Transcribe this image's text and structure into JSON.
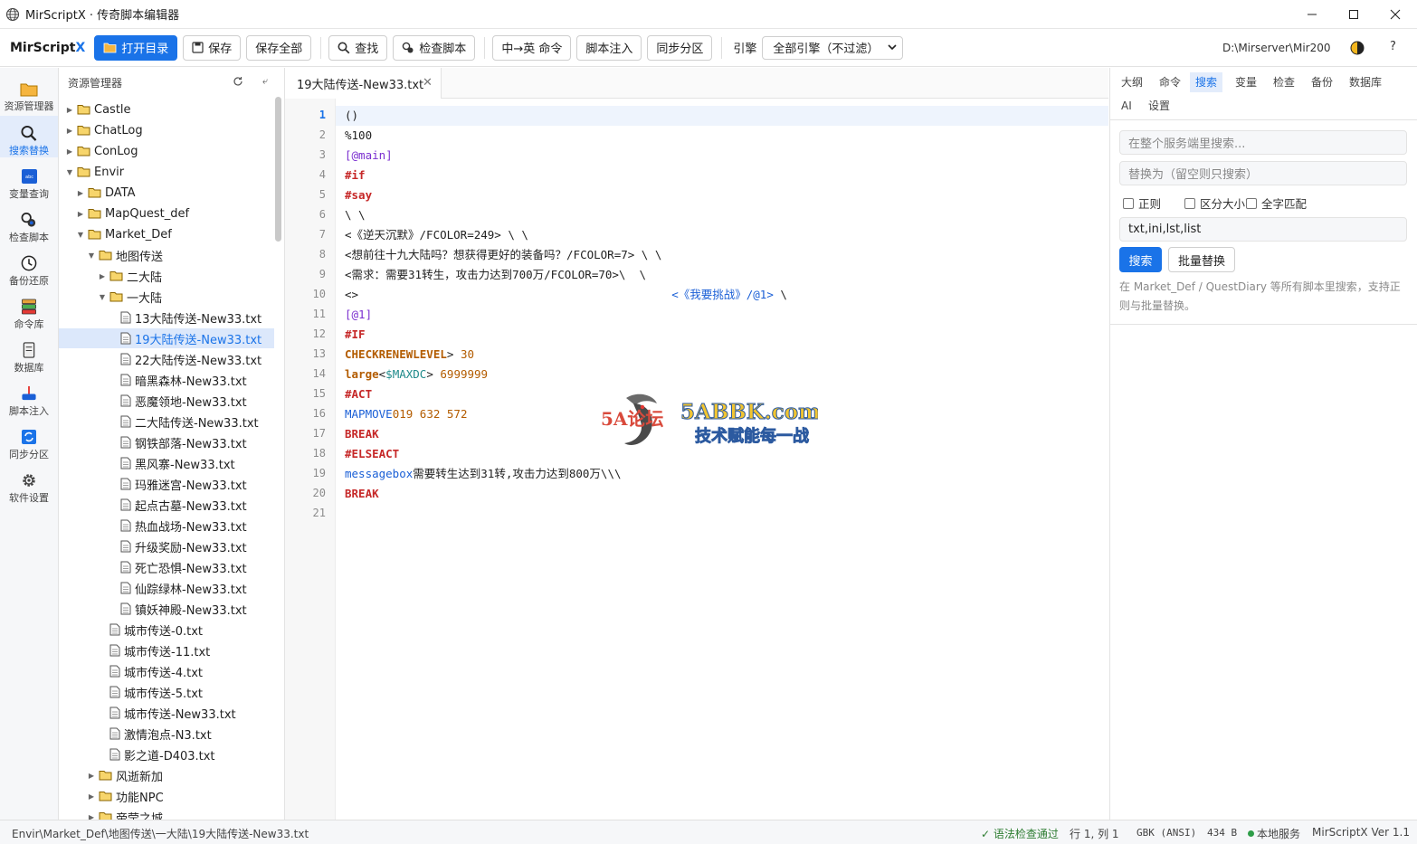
{
  "window": {
    "title": "MirScriptX · 传奇脚本编辑器"
  },
  "toolbar": {
    "brand_main": "MirScript",
    "brand_x": "X",
    "open_dir": "打开目录",
    "save": "保存",
    "save_all": "保存全部",
    "find": "查找",
    "check_script": "检查脚本",
    "translate_cmd": "中→英 命令",
    "inject": "脚本注入",
    "sync_zone": "同步分区",
    "engine_label": "引擎",
    "engine_select": "全部引擎（不过滤）",
    "server_path": "D:\\Mirserver\\Mir200",
    "help": "?"
  },
  "activity": [
    {
      "label": "资源管理器",
      "icon": "folder-icon"
    },
    {
      "label": "搜索替换",
      "icon": "search-icon"
    },
    {
      "label": "变量查询",
      "icon": "variable-icon"
    },
    {
      "label": "检查脚本",
      "icon": "bug-check-icon"
    },
    {
      "label": "备份还原",
      "icon": "clock-icon"
    },
    {
      "label": "命令库",
      "icon": "stack-icon"
    },
    {
      "label": "数据库",
      "icon": "database-icon"
    },
    {
      "label": "脚本注入",
      "icon": "inject-icon"
    },
    {
      "label": "同步分区",
      "icon": "sync-icon"
    },
    {
      "label": "软件设置",
      "icon": "gear-icon"
    }
  ],
  "explorer": {
    "title": "资源管理器",
    "tree": [
      {
        "label": "Castle",
        "depth": 0,
        "type": "folder",
        "expanded": false
      },
      {
        "label": "ChatLog",
        "depth": 0,
        "type": "folder",
        "expanded": false
      },
      {
        "label": "ConLog",
        "depth": 0,
        "type": "folder",
        "expanded": false
      },
      {
        "label": "Envir",
        "depth": 0,
        "type": "folder",
        "expanded": true
      },
      {
        "label": "DATA",
        "depth": 1,
        "type": "folder",
        "expanded": false
      },
      {
        "label": "MapQuest_def",
        "depth": 1,
        "type": "folder",
        "expanded": false
      },
      {
        "label": "Market_Def",
        "depth": 1,
        "type": "folder",
        "expanded": true
      },
      {
        "label": "地图传送",
        "depth": 2,
        "type": "folder",
        "expanded": true
      },
      {
        "label": "二大陆",
        "depth": 3,
        "type": "folder",
        "expanded": false
      },
      {
        "label": "一大陆",
        "depth": 3,
        "type": "folder",
        "expanded": true
      },
      {
        "label": "13大陆传送-New33.txt",
        "depth": 4,
        "type": "file"
      },
      {
        "label": "19大陆传送-New33.txt",
        "depth": 4,
        "type": "file",
        "selected": true
      },
      {
        "label": "22大陆传送-New33.txt",
        "depth": 4,
        "type": "file"
      },
      {
        "label": "暗黑森林-New33.txt",
        "depth": 4,
        "type": "file"
      },
      {
        "label": "恶魔领地-New33.txt",
        "depth": 4,
        "type": "file"
      },
      {
        "label": "二大陆传送-New33.txt",
        "depth": 4,
        "type": "file"
      },
      {
        "label": "钢铁部落-New33.txt",
        "depth": 4,
        "type": "file"
      },
      {
        "label": "黑风寨-New33.txt",
        "depth": 4,
        "type": "file"
      },
      {
        "label": "玛雅迷宫-New33.txt",
        "depth": 4,
        "type": "file"
      },
      {
        "label": "起点古墓-New33.txt",
        "depth": 4,
        "type": "file"
      },
      {
        "label": "热血战场-New33.txt",
        "depth": 4,
        "type": "file"
      },
      {
        "label": "升级奖励-New33.txt",
        "depth": 4,
        "type": "file"
      },
      {
        "label": "死亡恐惧-New33.txt",
        "depth": 4,
        "type": "file"
      },
      {
        "label": "仙踪绿林-New33.txt",
        "depth": 4,
        "type": "file"
      },
      {
        "label": "镇妖神殿-New33.txt",
        "depth": 4,
        "type": "file"
      },
      {
        "label": "城市传送-0.txt",
        "depth": 3,
        "type": "file"
      },
      {
        "label": "城市传送-11.txt",
        "depth": 3,
        "type": "file"
      },
      {
        "label": "城市传送-4.txt",
        "depth": 3,
        "type": "file"
      },
      {
        "label": "城市传送-5.txt",
        "depth": 3,
        "type": "file"
      },
      {
        "label": "城市传送-New33.txt",
        "depth": 3,
        "type": "file"
      },
      {
        "label": "激情泡点-N3.txt",
        "depth": 3,
        "type": "file"
      },
      {
        "label": "影之道-D403.txt",
        "depth": 3,
        "type": "file"
      },
      {
        "label": "风逝新加",
        "depth": 2,
        "type": "folder",
        "expanded": false
      },
      {
        "label": "功能NPC",
        "depth": 2,
        "type": "folder",
        "expanded": false
      },
      {
        "label": "帝莹之城",
        "depth": 2,
        "type": "folder",
        "expanded": false
      }
    ]
  },
  "editor": {
    "tab_title": "19大陆传送-New33.txt",
    "current_line": 1,
    "lines": [
      [
        {
          "t": "()",
          "c": ""
        }
      ],
      [
        {
          "t": "%100",
          "c": ""
        }
      ],
      [
        {
          "t": "[@main]",
          "c": "label"
        }
      ],
      [
        {
          "t": "#if",
          "c": "kw"
        }
      ],
      [
        {
          "t": "#say",
          "c": "kw"
        }
      ],
      [
        {
          "t": "\\ \\",
          "c": ""
        }
      ],
      [
        {
          "t": "<《逆天沉默》/FCOLOR=249> \\ \\",
          "c": ""
        }
      ],
      [
        {
          "t": "<想前往十九大陆吗？想获得更好的装备吗？/FCOLOR=7> \\ \\",
          "c": ""
        }
      ],
      [
        {
          "t": "<需求：需要31转生，攻击力达到700万/FCOLOR=70>\\  \\",
          "c": ""
        }
      ],
      [
        {
          "t": "<>                                              ",
          "c": ""
        },
        {
          "t": "<《我要挑战》/@1>",
          "c": "link"
        },
        {
          "t": " \\",
          "c": ""
        }
      ],
      [
        {
          "t": "[@1]",
          "c": "label"
        }
      ],
      [
        {
          "t": "#IF",
          "c": "kw"
        }
      ],
      [
        {
          "t": "CHECKRENEWLEVEL",
          "c": "fn"
        },
        {
          "t": "> ",
          "c": ""
        },
        {
          "t": "30",
          "c": "num"
        }
      ],
      [
        {
          "t": "large",
          "c": "fn"
        },
        {
          "t": "<",
          "c": ""
        },
        {
          "t": "$MAXDC",
          "c": "var"
        },
        {
          "t": "> ",
          "c": ""
        },
        {
          "t": "6999999",
          "c": "num"
        }
      ],
      [
        {
          "t": "#ACT",
          "c": "kw"
        }
      ],
      [
        {
          "t": "MAPMOVE",
          "c": "cmd"
        },
        {
          "t": "019 632 572",
          "c": "num"
        }
      ],
      [
        {
          "t": "BREAK",
          "c": "kw"
        }
      ],
      [
        {
          "t": "#ELSEACT",
          "c": "kw"
        }
      ],
      [
        {
          "t": "messagebox",
          "c": "cmd"
        },
        {
          "t": "需要转生达到31转,攻击力达到800万\\\\\\",
          "c": ""
        }
      ],
      [
        {
          "t": "BREAK",
          "c": "kw"
        }
      ],
      [
        {
          "t": "",
          "c": ""
        }
      ]
    ]
  },
  "watermark": {
    "logo_text": "5A论坛",
    "site": "5ABBK.com",
    "slogan": "技术赋能每一战"
  },
  "right_panel": {
    "tabs": [
      "大纲",
      "命令",
      "搜索",
      "变量",
      "检查",
      "备份",
      "数据库",
      "AI",
      "设置"
    ],
    "active_tab": "搜索",
    "search_placeholder": "在整个服务端里搜索...",
    "replace_placeholder": "替换为（留空则只搜索）",
    "opt_regex": "正则",
    "opt_case": "区分大小写",
    "opt_whole": "全字匹配",
    "ext_value": "txt,ini,lst,list",
    "btn_search": "搜索",
    "btn_replace": "批量替换",
    "hint": "在 Market_Def / QuestDiary 等所有脚本里搜索，支持正则与批量替换。"
  },
  "status": {
    "path": "Envir\\Market_Def\\地图传送\\一大陆\\19大陆传送-New33.txt",
    "syntax": "✓ 语法检查通过",
    "cursor": "行 1, 列 1",
    "encoding": "GBK (ANSI)",
    "size": "434 B",
    "service": "本地服务",
    "version": "MirScriptX Ver 1.1"
  }
}
